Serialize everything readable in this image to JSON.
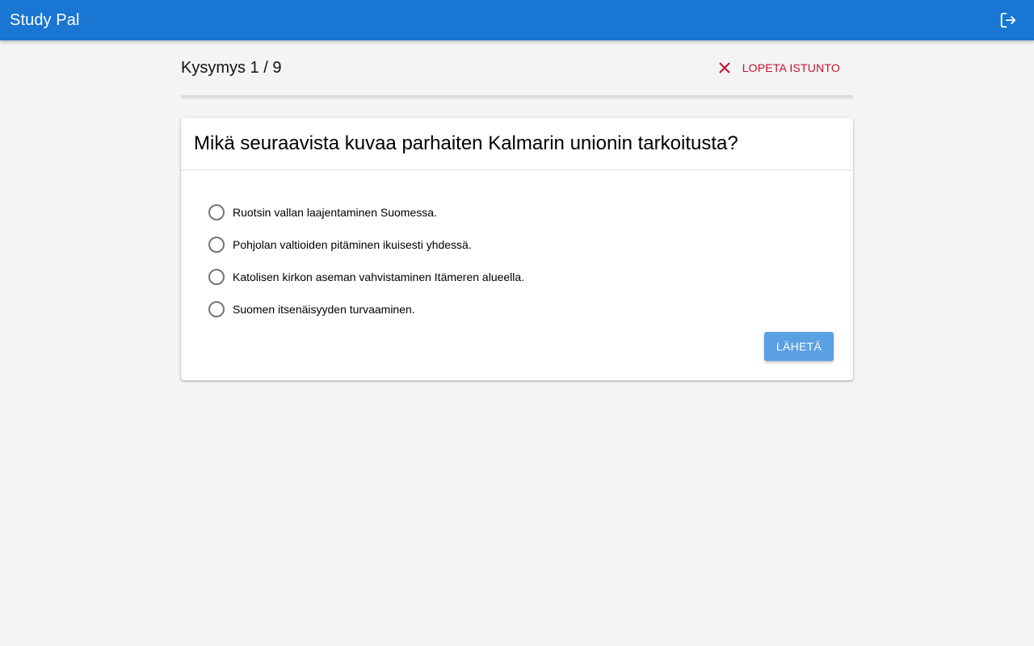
{
  "app": {
    "title": "Study Pal"
  },
  "session": {
    "counter": "Kysymys 1 / 9",
    "end_label": "LOPETA ISTUNTO",
    "progress": 0
  },
  "question": {
    "text": "Mikä seuraavista kuvaa parhaiten Kalmarin unionin tarkoitusta?",
    "options": [
      {
        "label": "Ruotsin vallan laajentaminen Suomessa."
      },
      {
        "label": "Pohjolan valtioiden pitäminen ikuisesti yhdessä."
      },
      {
        "label": "Katolisen kirkon aseman vahvistaminen Itämeren alueella."
      },
      {
        "label": "Suomen itsenäisyyden turvaaminen."
      }
    ],
    "submit_label": "LÄHETÄ"
  },
  "colors": {
    "appbar": "#1976d2",
    "end_session": "#c8102e",
    "submit_button": "#5ba0e3"
  },
  "icons": {
    "logout": "logout-icon",
    "end_session": "close-icon"
  }
}
